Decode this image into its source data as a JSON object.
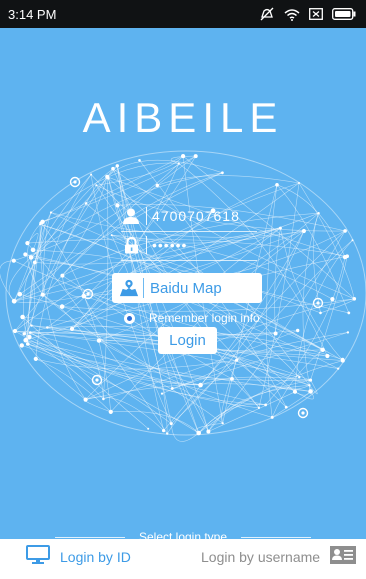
{
  "status_bar": {
    "time": "3:14 PM",
    "icons": [
      "mute-icon",
      "wifi-icon",
      "sim-icon",
      "battery-icon"
    ]
  },
  "app": {
    "title": "AIBEILE"
  },
  "login_form": {
    "user_id": "4700707618",
    "password_masked": "••••••",
    "server": "Baidu Map",
    "remember_label": "Remember login info",
    "remember_checked": true,
    "login_button": "Login"
  },
  "login_type": {
    "label": "Select login type",
    "options": [
      {
        "label": "Login by ID",
        "icon": "monitor-icon",
        "active": true
      },
      {
        "label": "Login by username",
        "icon": "id-card-icon",
        "active": false
      }
    ]
  },
  "colors": {
    "background": "#5eb3f0",
    "accent": "#3d9be6",
    "status_bar": "#101214",
    "inactive_text": "#8e8e8e"
  }
}
